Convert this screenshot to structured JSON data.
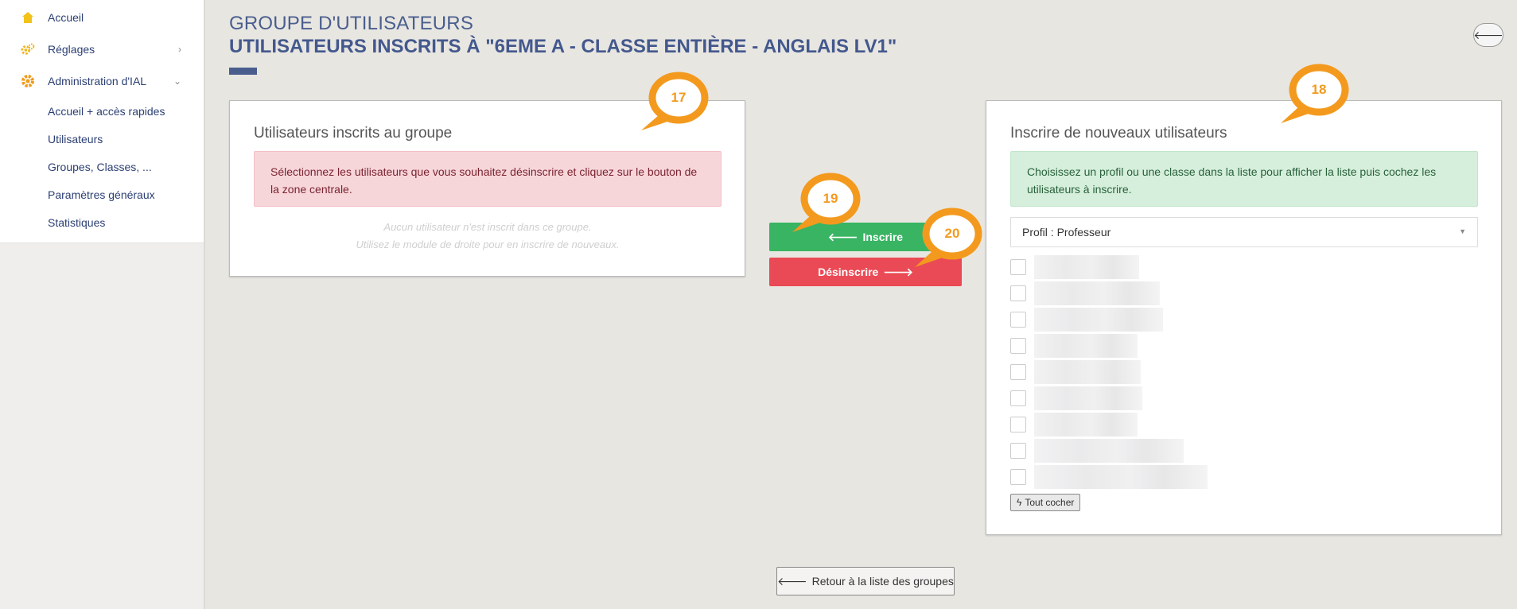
{
  "sidebar": {
    "items": [
      {
        "label": "Accueil",
        "icon": "home-icon"
      },
      {
        "label": "Réglages",
        "icon": "gears-icon"
      },
      {
        "label": "Administration d'IAL",
        "icon": "gear-icon"
      }
    ],
    "subitems": [
      {
        "label": "Accueil + accès rapides"
      },
      {
        "label": "Utilisateurs"
      },
      {
        "label": "Groupes, Classes, ..."
      },
      {
        "label": "Paramètres généraux"
      },
      {
        "label": "Statistiques"
      }
    ]
  },
  "header": {
    "title1": "GROUPE D'UTILISATEURS",
    "title2": "UTILISATEURS INSCRITS À \"6EME A - CLASSE ENTIÈRE - ANGLAIS LV1\""
  },
  "left_panel": {
    "title": "Utilisateurs inscrits au groupe",
    "alert": "Sélectionnez les utilisateurs que vous souhaitez désinscrire et cliquez sur le bouton de la zone centrale.",
    "empty_line1": "Aucun utilisateur n'est inscrit dans ce groupe.",
    "empty_line2": "Utilisez le module de droite pour en inscrire de nouveaux."
  },
  "right_panel": {
    "title": "Inscrire de nouveaux utilisateurs",
    "alert": "Choisissez un profil ou une classe dans la liste pour afficher la liste puis cochez les utilisateurs à inscrire.",
    "select_value": "Profil : Professeur",
    "check_all": "Tout cocher"
  },
  "buttons": {
    "inscrire": "Inscrire",
    "desinscrire": "Désinscrire",
    "back_list": "Retour à la liste des groupes"
  },
  "callouts": [
    "17",
    "18",
    "19",
    "20"
  ],
  "colors": {
    "accent": "#43588d",
    "callout": "#f39a1e",
    "green": "#38b463",
    "red": "#ea4a55"
  }
}
